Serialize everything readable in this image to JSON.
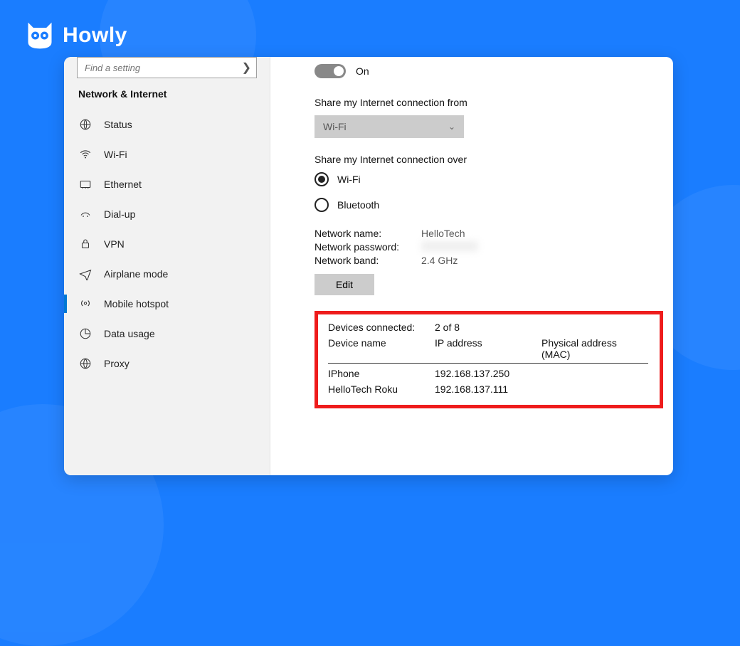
{
  "brand": {
    "name": "Howly"
  },
  "sidebar": {
    "search_placeholder": "Find a setting",
    "section_title": "Network & Internet",
    "items": [
      {
        "label": "Status"
      },
      {
        "label": "Wi-Fi"
      },
      {
        "label": "Ethernet"
      },
      {
        "label": "Dial-up"
      },
      {
        "label": "VPN"
      },
      {
        "label": "Airplane mode"
      },
      {
        "label": "Mobile hotspot"
      },
      {
        "label": "Data usage"
      },
      {
        "label": "Proxy"
      }
    ]
  },
  "main": {
    "toggle_label": "On",
    "share_from": {
      "label": "Share my Internet connection from",
      "selected": "Wi-Fi"
    },
    "share_over": {
      "label": "Share my Internet connection over",
      "options": [
        {
          "label": "Wi-Fi",
          "checked": true
        },
        {
          "label": "Bluetooth",
          "checked": false
        }
      ]
    },
    "network": {
      "name_label": "Network name:",
      "name_value": "HelloTech",
      "password_label": "Network password:",
      "band_label": "Network band:",
      "band_value": "2.4 GHz",
      "edit_label": "Edit"
    },
    "devices": {
      "connected_label": "Devices connected:",
      "connected_value": "2 of 8",
      "col_name": "Device name",
      "col_ip": "IP address",
      "col_mac": "Physical address (MAC)",
      "rows": [
        {
          "name": "IPhone",
          "ip": "192.168.137.250"
        },
        {
          "name": "HelloTech Roku",
          "ip": "192.168.137.111"
        }
      ]
    }
  }
}
